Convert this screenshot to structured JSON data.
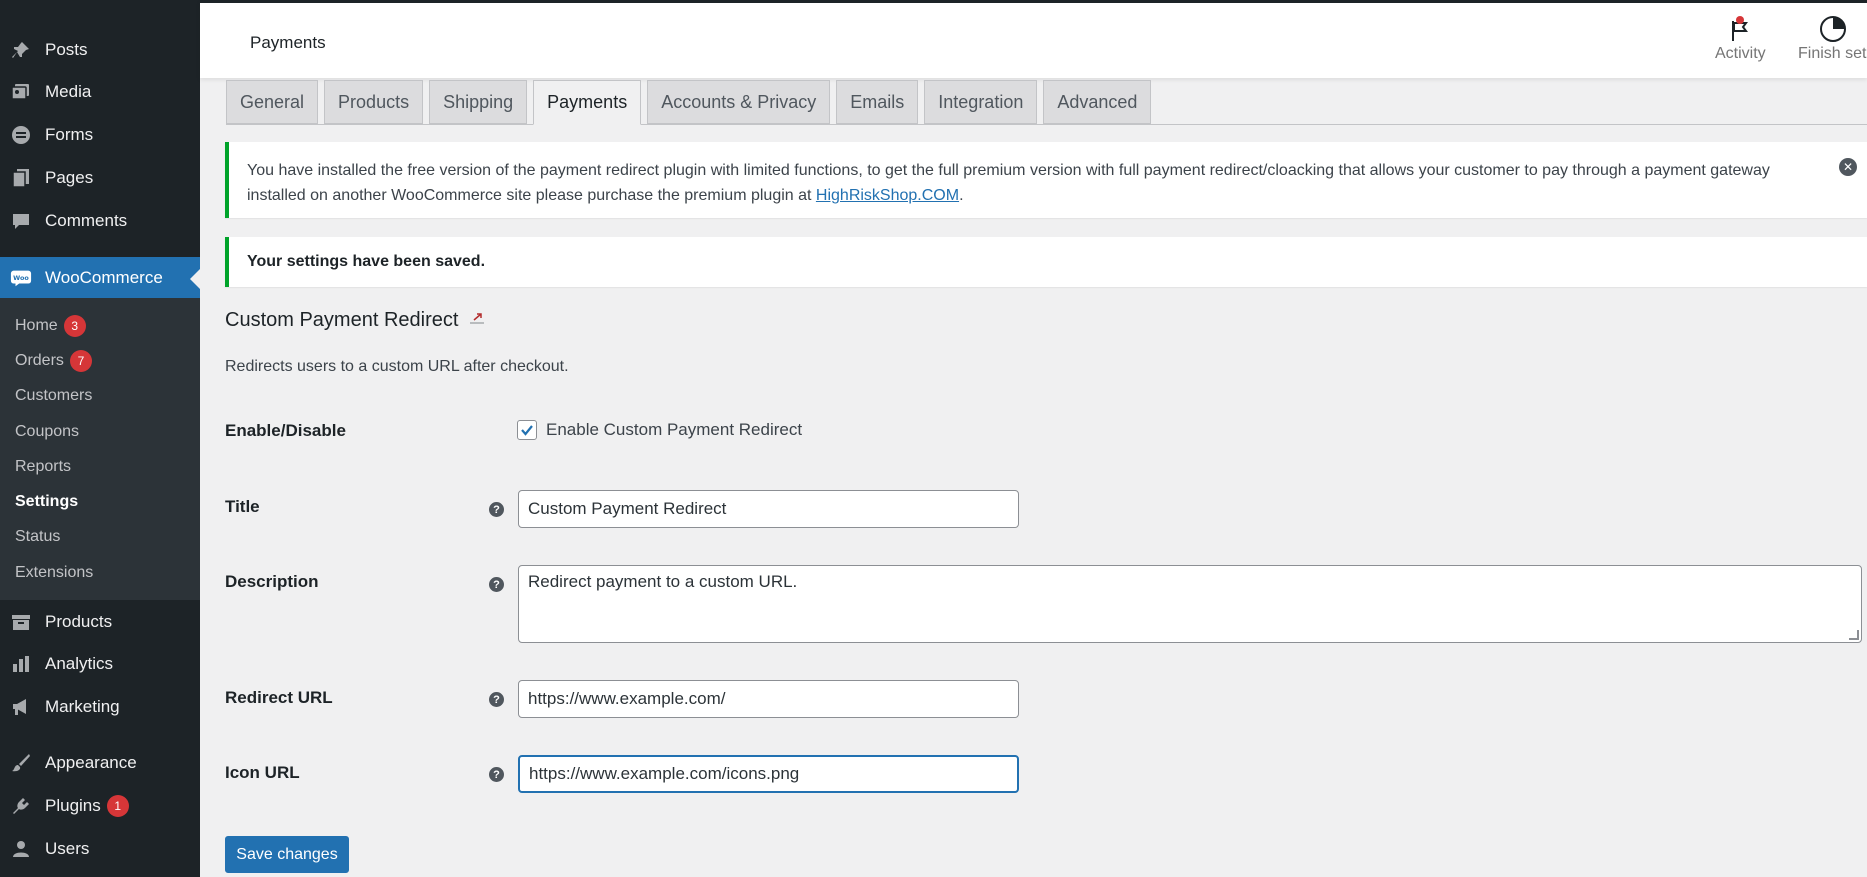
{
  "sidebar": {
    "items": [
      {
        "label": "Posts",
        "icon": "pin-icon"
      },
      {
        "label": "Media",
        "icon": "media-icon"
      },
      {
        "label": "Forms",
        "icon": "forms-icon"
      },
      {
        "label": "Pages",
        "icon": "pages-icon"
      },
      {
        "label": "Comments",
        "icon": "comment-icon"
      },
      {
        "label": "WooCommerce",
        "icon": "woo-icon"
      },
      {
        "label": "Products",
        "icon": "archive-icon"
      },
      {
        "label": "Analytics",
        "icon": "chart-icon"
      },
      {
        "label": "Marketing",
        "icon": "megaphone-icon"
      },
      {
        "label": "Appearance",
        "icon": "brush-icon"
      },
      {
        "label": "Plugins",
        "icon": "plugin-icon",
        "badge": "1"
      },
      {
        "label": "Users",
        "icon": "user-icon"
      }
    ],
    "submenu": [
      {
        "label": "Home",
        "badge": "3"
      },
      {
        "label": "Orders",
        "badge": "7"
      },
      {
        "label": "Customers"
      },
      {
        "label": "Coupons"
      },
      {
        "label": "Reports"
      },
      {
        "label": "Settings"
      },
      {
        "label": "Status"
      },
      {
        "label": "Extensions"
      }
    ]
  },
  "header": {
    "title": "Payments",
    "activity_label": "Activity",
    "finish_label": "Finish setup"
  },
  "tabs": [
    "General",
    "Products",
    "Shipping",
    "Payments",
    "Accounts & Privacy",
    "Emails",
    "Integration",
    "Advanced"
  ],
  "active_tab": "Payments",
  "notices": {
    "plugin_text": "You have installed the free version of the payment redirect plugin with limited functions, to get the full premium version with full payment redirect/cloacking that allows your customer to pay through a payment gateway installed on another WooCommerce site please purchase the premium plugin at ",
    "plugin_link": "HighRiskShop.COM",
    "plugin_end": ".",
    "saved_text": "Your settings have been saved."
  },
  "section": {
    "title": "Custom Payment Redirect",
    "description": "Redirects users to a custom URL after checkout."
  },
  "fields": {
    "enable_label": "Enable/Disable",
    "enable_checkbox_label": "Enable Custom Payment Redirect",
    "enable_checked": true,
    "title_label": "Title",
    "title_value": "Custom Payment Redirect",
    "description_label": "Description",
    "description_value": "Redirect payment to a custom URL.",
    "redirect_label": "Redirect URL",
    "redirect_value": "https://www.example.com/",
    "icon_label": "Icon URL",
    "icon_value": "https://www.example.com/icons.png"
  },
  "save_button": "Save changes",
  "colors": {
    "accent": "#2271b1",
    "sidebar_bg": "#1d2327",
    "success": "#00a32a",
    "badge": "#d63638"
  }
}
